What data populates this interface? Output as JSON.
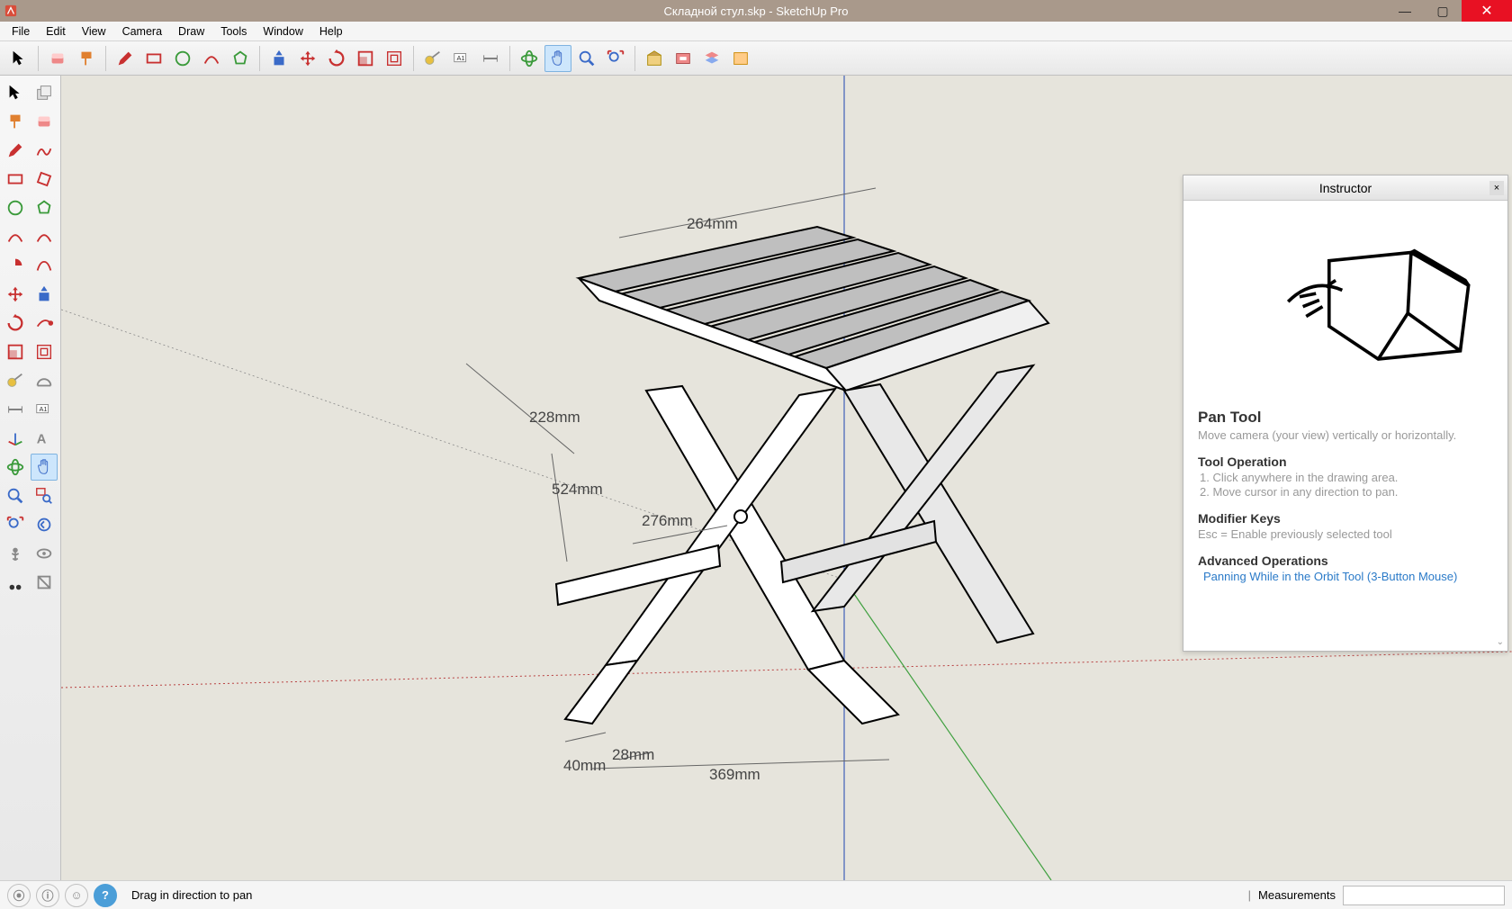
{
  "titlebar": {
    "title": "Складной стул.skp - SketchUp Pro",
    "min": "—",
    "max": "▢",
    "close": "✕"
  },
  "menu": [
    "File",
    "Edit",
    "View",
    "Camera",
    "Draw",
    "Tools",
    "Window",
    "Help"
  ],
  "toptools": [
    {
      "name": "select-tool",
      "ico": "arrow"
    },
    {
      "name": "eraser-tool",
      "ico": "eraser"
    },
    {
      "name": "paint-tool",
      "ico": "paint"
    },
    {
      "name": "line-tool",
      "ico": "pencil"
    },
    {
      "name": "rectangle-tool",
      "ico": "rect"
    },
    {
      "name": "circle-tool",
      "ico": "circle"
    },
    {
      "name": "arc-tool",
      "ico": "arc"
    },
    {
      "name": "polygon-tool",
      "ico": "poly"
    },
    {
      "name": "pushpull-tool",
      "ico": "pushpull"
    },
    {
      "name": "move-tool",
      "ico": "move"
    },
    {
      "name": "rotate-tool",
      "ico": "rotate"
    },
    {
      "name": "scale-tool",
      "ico": "scale"
    },
    {
      "name": "offset-tool",
      "ico": "offset"
    },
    {
      "name": "tape-tool",
      "ico": "tape"
    },
    {
      "name": "text-tool",
      "ico": "text"
    },
    {
      "name": "dimension-tool",
      "ico": "dim"
    },
    {
      "name": "orbit-tool",
      "ico": "orbit"
    },
    {
      "name": "pan-tool",
      "ico": "pan",
      "active": true
    },
    {
      "name": "zoom-tool",
      "ico": "zoom"
    },
    {
      "name": "zoom-extents-tool",
      "ico": "zoomext"
    },
    {
      "name": "warehouse-tool",
      "ico": "wh"
    },
    {
      "name": "extension-tool",
      "ico": "ext"
    },
    {
      "name": "layers-tool",
      "ico": "layers"
    },
    {
      "name": "outliner-tool",
      "ico": "outliner"
    }
  ],
  "lefttools": [
    [
      {
        "name": "select-tool",
        "ico": "arrow"
      },
      {
        "name": "component-tool",
        "ico": "component"
      }
    ],
    [
      {
        "name": "paint-tool",
        "ico": "paint2"
      },
      {
        "name": "eraser-tool",
        "ico": "eraser2"
      }
    ],
    [
      {
        "name": "line-tool",
        "ico": "pencil2"
      },
      {
        "name": "freehand-tool",
        "ico": "freehand"
      }
    ],
    [
      {
        "name": "rectangle-tool",
        "ico": "rect2"
      },
      {
        "name": "rotrect-tool",
        "ico": "rotrect"
      }
    ],
    [
      {
        "name": "circle-tool",
        "ico": "circle2"
      },
      {
        "name": "polygon-tool",
        "ico": "poly2"
      }
    ],
    [
      {
        "name": "arc-tool",
        "ico": "arc2"
      },
      {
        "name": "arc2-tool",
        "ico": "arc3"
      }
    ],
    [
      {
        "name": "pie-tool",
        "ico": "pie"
      },
      {
        "name": "bezier-tool",
        "ico": "bez"
      }
    ],
    [
      {
        "name": "move-tool",
        "ico": "move2"
      },
      {
        "name": "pushpull-tool",
        "ico": "push2"
      }
    ],
    [
      {
        "name": "rotate-tool",
        "ico": "rotate2"
      },
      {
        "name": "followme-tool",
        "ico": "follow"
      }
    ],
    [
      {
        "name": "scale-tool",
        "ico": "scale2"
      },
      {
        "name": "offset-tool",
        "ico": "offset2"
      }
    ],
    [
      {
        "name": "tape-tool",
        "ico": "tape2"
      },
      {
        "name": "protractor-tool",
        "ico": "prot"
      }
    ],
    [
      {
        "name": "dimension-tool",
        "ico": "dim2"
      },
      {
        "name": "text-tool",
        "ico": "text2"
      }
    ],
    [
      {
        "name": "axes-tool",
        "ico": "axes"
      },
      {
        "name": "3dtext-tool",
        "ico": "3dtext"
      }
    ],
    [
      {
        "name": "orbit-tool",
        "ico": "orbit2"
      },
      {
        "name": "pan-tool",
        "ico": "pan2",
        "active": true
      }
    ],
    [
      {
        "name": "zoom-tool",
        "ico": "zoom2"
      },
      {
        "name": "zoomwin-tool",
        "ico": "zoomwin"
      }
    ],
    [
      {
        "name": "zoomext-tool",
        "ico": "zoomext2"
      },
      {
        "name": "prev-tool",
        "ico": "prev"
      }
    ],
    [
      {
        "name": "position-tool",
        "ico": "pos"
      },
      {
        "name": "look-tool",
        "ico": "look"
      }
    ],
    [
      {
        "name": "walk-tool",
        "ico": "walk"
      },
      {
        "name": "section-tool",
        "ico": "section"
      }
    ]
  ],
  "dimensions": {
    "d264": "264mm",
    "d228": "228mm",
    "d524": "524mm",
    "d276": "276mm",
    "d369": "369mm",
    "d40": "40mm",
    "d28": "28mm"
  },
  "instructor": {
    "title": "Instructor",
    "toolname": "Pan Tool",
    "tooldesc": "Move camera (your view) vertically or horizontally.",
    "op_hdr": "Tool Operation",
    "op_steps": [
      "Click anywhere in the drawing area.",
      "Move cursor in any direction to pan."
    ],
    "mod_hdr": "Modifier Keys",
    "mod_text": "Esc = Enable previously selected tool",
    "adv_hdr": "Advanced Operations",
    "adv_link": "Panning While in the Orbit Tool (3-Button Mouse)"
  },
  "status": {
    "hint": "Drag in direction to pan",
    "meas_label": "Measurements",
    "meas_value": ""
  }
}
